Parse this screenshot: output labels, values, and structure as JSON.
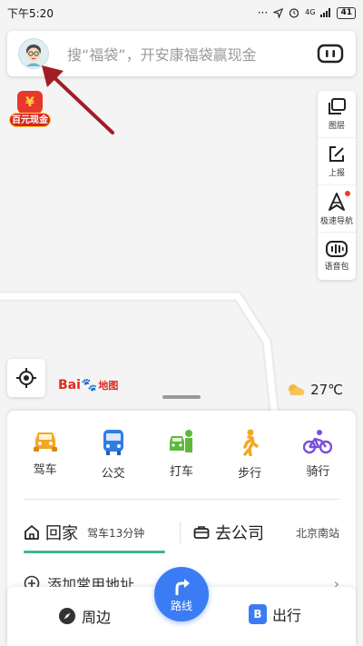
{
  "status_bar": {
    "time": "下午5:20",
    "signal_label": "4G",
    "battery": "41"
  },
  "search": {
    "placeholder": "搜“福袋”，开安康福袋赢现金"
  },
  "promo": {
    "label": "百元现金",
    "bag_symbol": "¥"
  },
  "tools": [
    {
      "label": "图层",
      "icon": "layers-icon"
    },
    {
      "label": "上报",
      "icon": "report-icon"
    },
    {
      "label": "极速导航",
      "icon": "navigation-icon"
    },
    {
      "label": "语音包",
      "icon": "voice-pack-icon"
    }
  ],
  "map": {
    "logo_bai": "Bai",
    "logo_paw": "🐾",
    "logo_map": "地图",
    "temperature": "27℃",
    "weather_icon": "partly-cloudy-icon"
  },
  "modes": [
    {
      "label": "驾车",
      "icon": "car-icon",
      "color": "#f5a623"
    },
    {
      "label": "公交",
      "icon": "bus-icon",
      "color": "#2f7de1"
    },
    {
      "label": "打车",
      "icon": "taxi-icon",
      "color": "#5fb83c"
    },
    {
      "label": "步行",
      "icon": "walk-icon",
      "color": "#f5a623"
    },
    {
      "label": "骑行",
      "icon": "bike-icon",
      "color": "#7b4fd9"
    }
  ],
  "shortcuts": {
    "home_label": "回家",
    "home_detail": "驾车13分钟",
    "work_label": "去公司",
    "work_detail": "北京南站",
    "add_label": "添加常用地址",
    "add_arrow": "›"
  },
  "bottom_nav": {
    "nearby_label": "周边",
    "route_label": "路线",
    "trip_label": "出行",
    "trip_icon_letter": "B"
  },
  "colors": {
    "accent_blue": "#3b7cf4",
    "home_underline": "#3db88c",
    "annotation_red": "#a31d24"
  }
}
